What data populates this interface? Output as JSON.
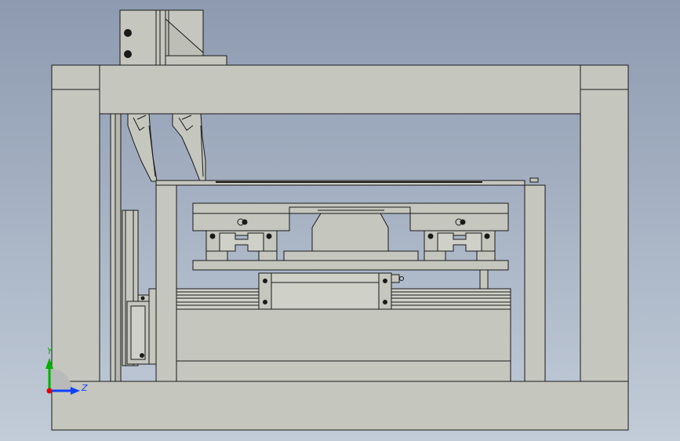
{
  "viewport": {
    "background_top": "#8d9ab0",
    "background_bottom": "#c2ccd8"
  },
  "part_colors": {
    "body": "#c5c6be",
    "body_dark": "#b6b7ae",
    "edge": "#1a1a1a",
    "rail": "#cfd0c8"
  },
  "triad": {
    "y_label": "Y",
    "z_label": "Z",
    "y_color": "#00b000",
    "z_color": "#1040ff",
    "x_color": "#e00000"
  }
}
